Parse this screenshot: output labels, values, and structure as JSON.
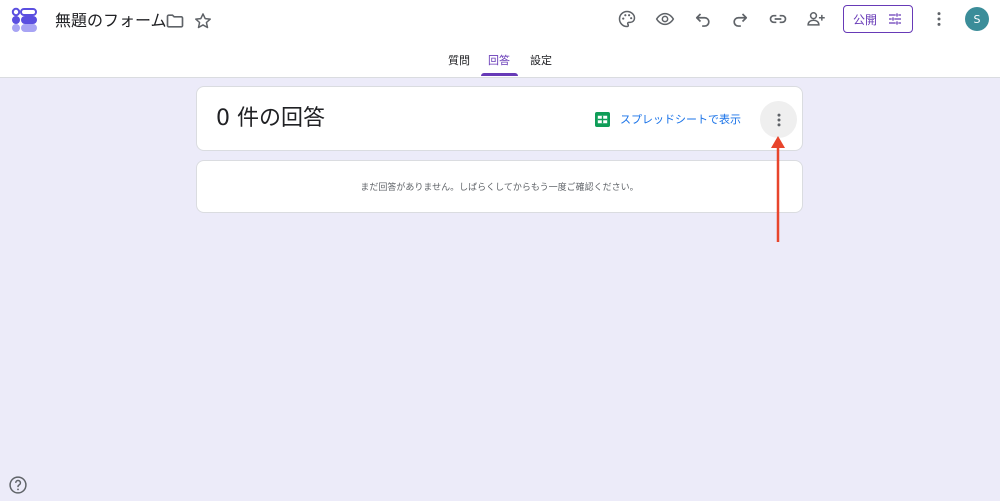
{
  "header": {
    "title": "無題のフォーム",
    "publish_label": "公開",
    "avatar_initial": "S"
  },
  "tabs": [
    {
      "label": "質問",
      "active": false
    },
    {
      "label": "回答",
      "active": true
    },
    {
      "label": "設定",
      "active": false
    }
  ],
  "responses": {
    "count_title": "0 件の回答",
    "sheets_link_label": "スプレッドシートで表示",
    "empty_message": "まだ回答がありません。しばらくしてからもう一度ご確認ください。"
  },
  "colors": {
    "accent": "#673ab7",
    "background": "#ecebf9",
    "link": "#1a73e8",
    "sheets_green": "#0f9d58",
    "annotation_arrow": "#e8452c",
    "avatar": "#3b8d99"
  },
  "icons": [
    "forms-logo-icon",
    "folder-icon",
    "star-icon",
    "palette-icon",
    "preview-eye-icon",
    "undo-icon",
    "redo-icon",
    "link-icon",
    "add-collaborator-icon",
    "tune-icon",
    "more-vert-icon",
    "sheets-icon",
    "help-icon"
  ]
}
